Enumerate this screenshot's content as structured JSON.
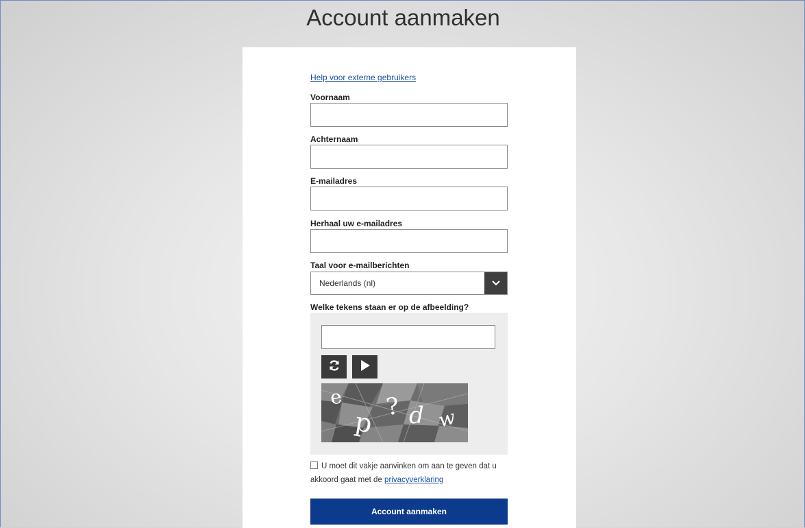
{
  "page": {
    "title": "Account aanmaken"
  },
  "form": {
    "help_link": "Help voor externe gebruikers",
    "first_name": {
      "label": "Voornaam",
      "value": ""
    },
    "last_name": {
      "label": "Achternaam",
      "value": ""
    },
    "email": {
      "label": "E-mailadres",
      "value": ""
    },
    "email_repeat": {
      "label": "Herhaal uw e-mailadres",
      "value": ""
    },
    "language": {
      "label": "Taal voor e-mailberichten",
      "selected": "Nederlands (nl)"
    },
    "captcha": {
      "label": "Welke tekens staan er op de afbeelding?",
      "value": "",
      "image_text": "e p ? d w",
      "refresh_icon": "refresh-icon",
      "audio_icon": "play-icon"
    },
    "consent": {
      "checked": false,
      "text": "U moet dit vakje aanvinken om aan te geven dat u akkoord gaat met de ",
      "link": "privacyverklaring"
    },
    "submit_label": "Account aanmaken"
  },
  "colors": {
    "primary_button": "#0c3a8c",
    "link": "#1b4fa6",
    "dark_controls": "#3a3a3a"
  }
}
